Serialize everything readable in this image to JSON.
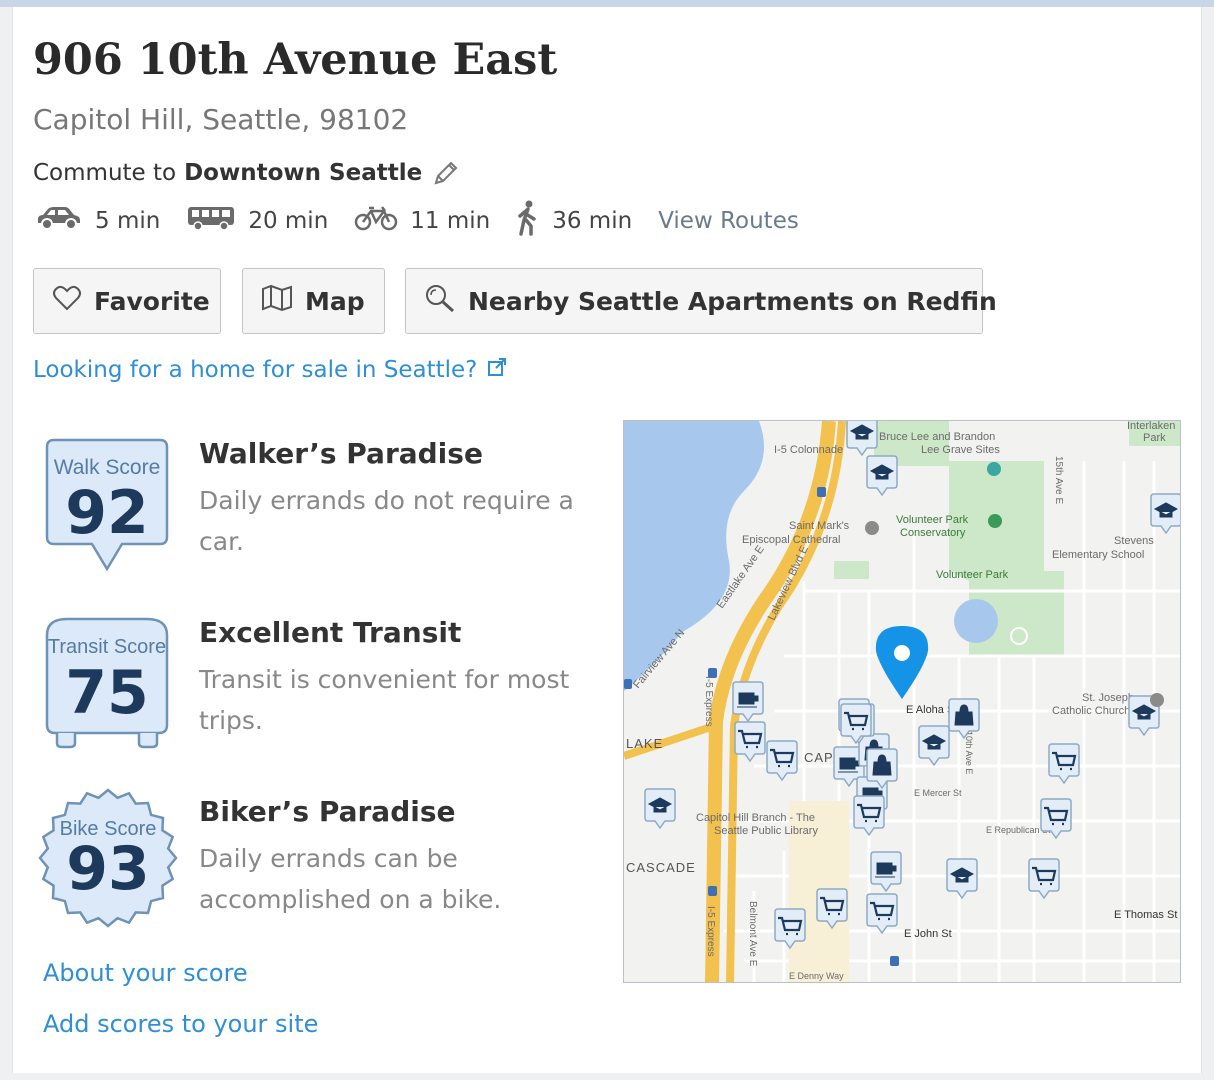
{
  "address": {
    "title": "906 10th Avenue East",
    "subtitle": "Capitol Hill, Seattle, 98102"
  },
  "commute": {
    "prefix": "Commute to",
    "destination": "Downtown Seattle",
    "modes": [
      {
        "icon": "car-icon",
        "time": "5 min"
      },
      {
        "icon": "bus-icon",
        "time": "20 min"
      },
      {
        "icon": "bike-icon",
        "time": "11 min"
      },
      {
        "icon": "walk-icon",
        "time": "36 min"
      }
    ],
    "view_routes": "View Routes"
  },
  "buttons": {
    "favorite": "Favorite",
    "map": "Map",
    "nearby": "Nearby Seattle Apartments on Redfin"
  },
  "home_link": "Looking for a home for sale in Seattle?",
  "scores": [
    {
      "label": "Walk Score",
      "value": "92",
      "title": "Walker’s Paradise",
      "desc": "Daily errands do not require a car."
    },
    {
      "label": "Transit Score",
      "value": "75",
      "title": "Excellent Transit",
      "desc": "Transit is convenient for most trips."
    },
    {
      "label": "Bike Score",
      "value": "93",
      "title": "Biker’s Paradise",
      "desc": "Daily errands can be accomplished on a bike."
    }
  ],
  "footer": {
    "about": "About your score",
    "add": "Add scores to your site"
  },
  "map": {
    "labels": {
      "colonnade": "I-5 Colonnade",
      "bruce_lee_1": "Bruce Lee and Brandon",
      "bruce_lee_2": "Lee Grave Sites",
      "interlaken_1": "Interlaken",
      "interlaken_2": "Park",
      "st_marks_1": "Saint Mark's",
      "st_marks_2": "Episcopal Cathedral",
      "conservatory_1": "Volunteer Park",
      "conservatory_2": "Conservatory",
      "volunteer_park": "Volunteer Park",
      "stevens_1": "Stevens",
      "stevens_2": "Elementary School",
      "st_joseph_1": "St. Joseph",
      "st_joseph_2": "Catholic Church",
      "library_1": "Capitol Hill Branch - The",
      "library_2": "Seattle Public Library",
      "aloha": "E Aloha St",
      "capitol": "CAPITOL",
      "lake": "LAKE",
      "cascade": "CASCADE",
      "john": "E John St",
      "thomas": "E Thomas St",
      "eastlake": "Eastlake Ave E",
      "lakeview": "Lakeview Blvd E",
      "fairview": "Fairview Ave N",
      "i5_express_1": "I-5 Express",
      "i5_express_2": "I-5 Express",
      "ave15": "15th Ave E",
      "ave10": "10th Ave E",
      "mercer": "E Mercer St",
      "republican": "E Republican St",
      "denny": "E Denny Way",
      "belmont": "Belmont Ave E"
    }
  },
  "colors": {
    "link": "#2f8fd6",
    "badge_fill": "#dce9f8",
    "badge_stroke": "#6f93b6",
    "badge_text": "#1d3a5c",
    "map_pin": "#1593e6",
    "highway": "#f2c14e"
  }
}
